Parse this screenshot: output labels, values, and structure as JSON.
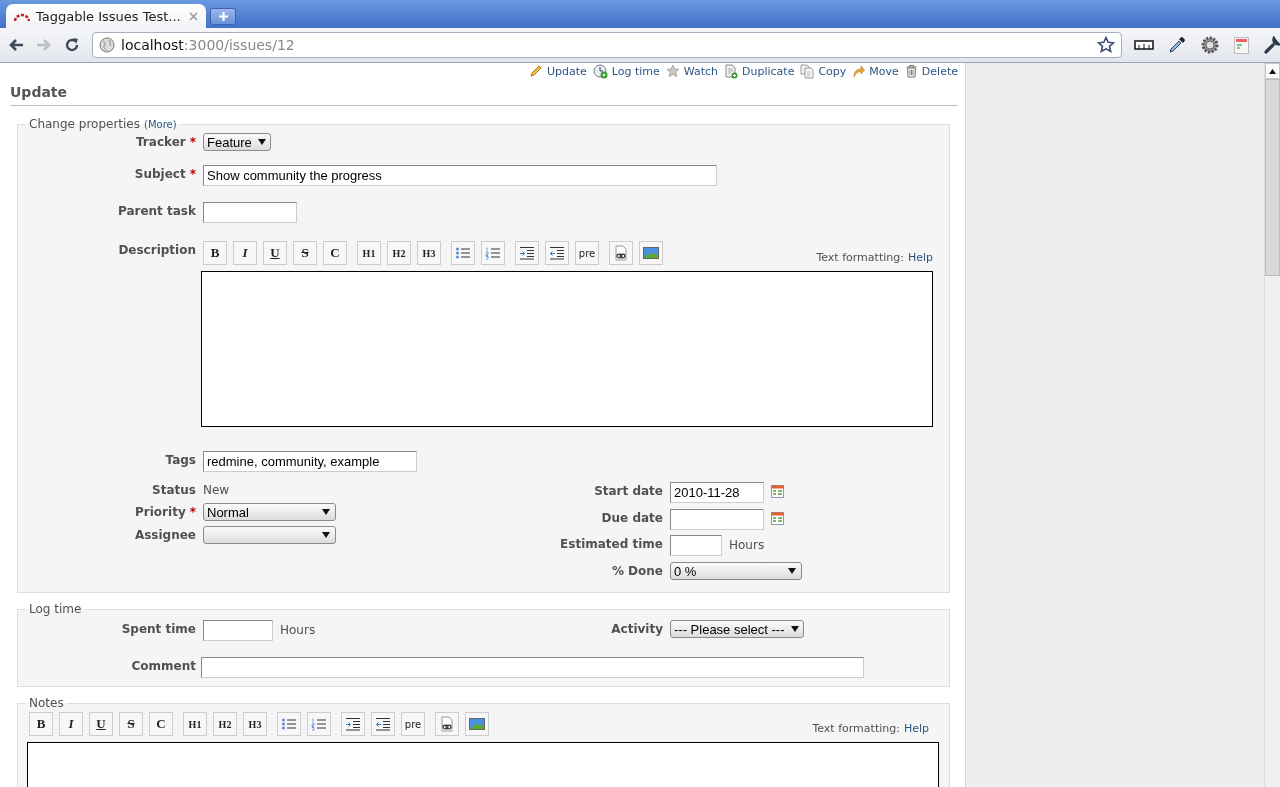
{
  "browser": {
    "tab_title": "Taggable Issues Test...",
    "url_host": "localhost",
    "url_path": ":3000/issues/12",
    "forward_disabled": true
  },
  "actions": [
    {
      "kind": "pencil",
      "label": "Update"
    },
    {
      "kind": "clock",
      "label": "Log time"
    },
    {
      "kind": "star",
      "label": "Watch"
    },
    {
      "kind": "document-add",
      "label": "Duplicate"
    },
    {
      "kind": "copy",
      "label": "Copy"
    },
    {
      "kind": "move",
      "label": "Move"
    },
    {
      "kind": "trash",
      "label": "Delete"
    }
  ],
  "heading": "Update",
  "properties": {
    "legend": "Change properties",
    "more_link": "(More)",
    "tracker": {
      "label": "Tracker",
      "marker": "*",
      "value": "Feature"
    },
    "subject": {
      "label": "Subject",
      "marker": "*",
      "value": "Show community the progress"
    },
    "parent_task": {
      "label": "Parent task"
    },
    "description": {
      "label": "Description",
      "formatting_label": "Text formatting:",
      "help_link": "Help",
      "toolbar": [
        [
          {
            "kind": "bold",
            "label": "B"
          },
          {
            "kind": "italic",
            "label": "I"
          },
          {
            "kind": "underline",
            "label": "U"
          },
          {
            "kind": "strike",
            "label": "S"
          },
          {
            "kind": "code",
            "label": "C"
          }
        ],
        [
          {
            "kind": "heading",
            "label": "H1"
          },
          {
            "kind": "heading",
            "label": "H2"
          },
          {
            "kind": "heading",
            "label": "H3"
          }
        ],
        [
          {
            "kind": "bullets"
          },
          {
            "kind": "numbers"
          }
        ],
        [
          {
            "kind": "indent"
          },
          {
            "kind": "outdent"
          },
          {
            "kind": "pre",
            "label": "pre"
          }
        ],
        [
          {
            "kind": "link"
          },
          {
            "kind": "image"
          }
        ]
      ]
    },
    "tags": {
      "label": "Tags",
      "value": "redmine, community, example"
    },
    "status": {
      "label": "Status",
      "value": "New"
    },
    "priority": {
      "label": "Priority",
      "marker": "*",
      "value": "Normal"
    },
    "assignee": {
      "label": "Assignee"
    },
    "start_date": {
      "label": "Start date",
      "value": "2010-11-28"
    },
    "due_date": {
      "label": "Due date"
    },
    "estimated_time": {
      "label": "Estimated time",
      "unit": "Hours"
    },
    "done": {
      "label": "% Done",
      "value": "0 %"
    }
  },
  "log_time": {
    "legend": "Log time",
    "spent_time": {
      "label": "Spent time",
      "unit": "Hours"
    },
    "activity": {
      "label": "Activity",
      "value": "--- Please select ---"
    },
    "comment": {
      "label": "Comment"
    }
  },
  "notes": {
    "legend": "Notes",
    "formatting_label": "Text formatting:",
    "help_link": "Help",
    "toolbar": [
      [
        {
          "kind": "bold",
          "label": "B"
        },
        {
          "kind": "italic",
          "label": "I"
        },
        {
          "kind": "underline",
          "label": "U"
        },
        {
          "kind": "strike",
          "label": "S"
        },
        {
          "kind": "code",
          "label": "C"
        }
      ],
      [
        {
          "kind": "heading",
          "label": "H1"
        },
        {
          "kind": "heading",
          "label": "H2"
        },
        {
          "kind": "heading",
          "label": "H3"
        }
      ],
      [
        {
          "kind": "bullets"
        },
        {
          "kind": "numbers"
        }
      ],
      [
        {
          "kind": "indent"
        },
        {
          "kind": "outdent"
        },
        {
          "kind": "pre",
          "label": "pre"
        }
      ],
      [
        {
          "kind": "link"
        },
        {
          "kind": "image"
        }
      ]
    ]
  }
}
